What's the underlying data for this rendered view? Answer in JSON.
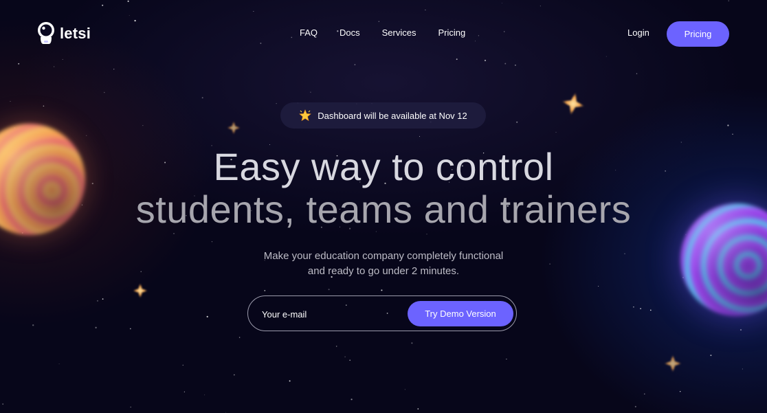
{
  "nav": {
    "logo_text": "letsi",
    "links": [
      {
        "label": "FAQ"
      },
      {
        "label": "Docs"
      },
      {
        "label": "Services"
      },
      {
        "label": "Pricing"
      }
    ],
    "login_label": "Login",
    "pricing_button_label": "Pricing"
  },
  "announcement": {
    "icon": "star-emoji-icon",
    "text": "Dashboard will be available at Nov 12"
  },
  "hero": {
    "headline_line1": "Easy way to control",
    "headline_line2": "students, teams and trainers",
    "subtitle_line1": "Make your education company completely functional",
    "subtitle_line2": "and ready to go under 2 minutes."
  },
  "signup": {
    "email_placeholder": "Your e-mail",
    "button_label": "Try Demo Version"
  },
  "colors": {
    "background": "#07061a",
    "accent": "#6c63ff",
    "text": "#ffffff"
  }
}
